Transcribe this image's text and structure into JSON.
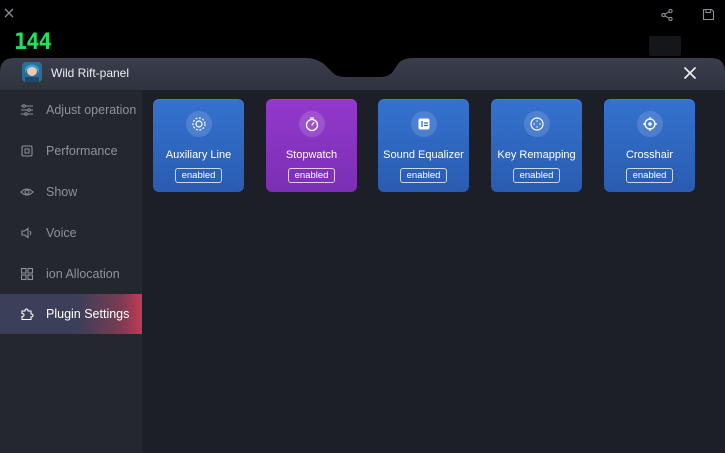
{
  "status_overlay": {
    "fps": "144"
  },
  "panel": {
    "title": "Wild Rift-panel"
  },
  "sidebar": {
    "items": [
      {
        "label": "Adjust operation",
        "icon": "sliders-icon"
      },
      {
        "label": "Performance",
        "icon": "chip-icon"
      },
      {
        "label": "Show",
        "icon": "eye-icon"
      },
      {
        "label": "Voice",
        "icon": "speaker-icon"
      },
      {
        "label": "ion Allocation",
        "icon": "grid-icon"
      },
      {
        "label": "Plugin Settings",
        "icon": "puzzle-icon",
        "active": true
      }
    ]
  },
  "plugins": [
    {
      "title": "Auxiliary Line",
      "status": "enabled",
      "icon": "aux-line-icon",
      "color": "#2f68c3"
    },
    {
      "title": "Stopwatch",
      "status": "enabled",
      "icon": "stopwatch-icon",
      "color": "#8a34c2"
    },
    {
      "title": "Sound Equalizer",
      "status": "enabled",
      "icon": "equalizer-icon",
      "color": "#2f68c3"
    },
    {
      "title": "Key Remapping",
      "status": "enabled",
      "icon": "gamepad-icon",
      "color": "#2f68c3"
    },
    {
      "title": "Crosshair",
      "status": "enabled",
      "icon": "crosshair-icon",
      "color": "#2f68c3"
    }
  ],
  "colors": {
    "accent_active": "#c23a55",
    "fps_green": "#1fe35a",
    "panel_bg": "#1c1f27",
    "sidebar_bg": "#24272e"
  }
}
